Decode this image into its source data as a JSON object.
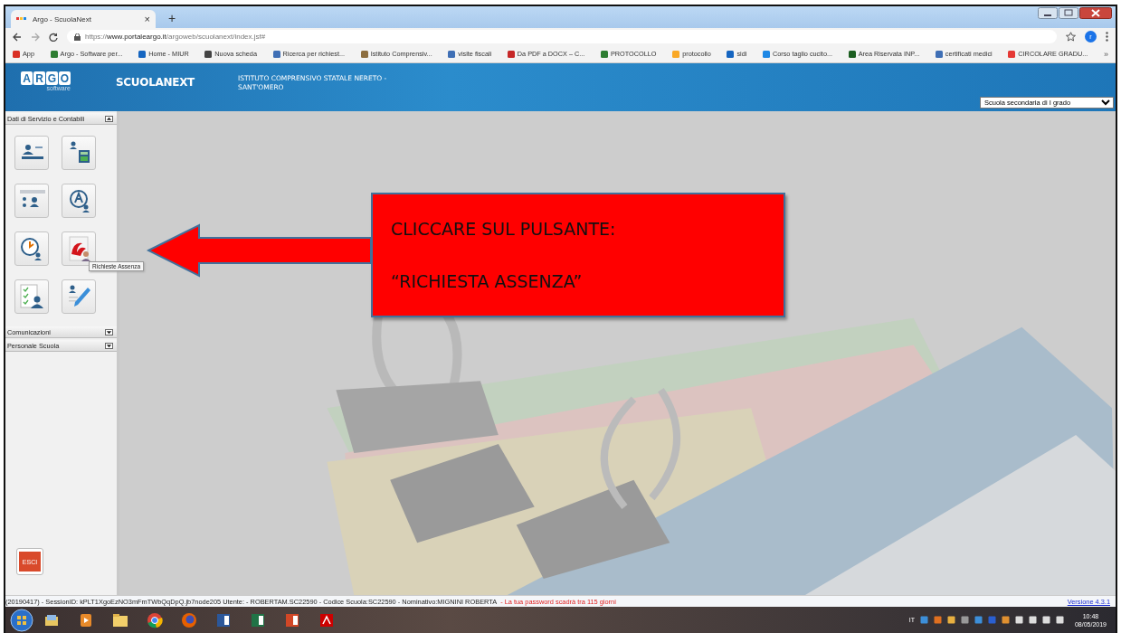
{
  "browser": {
    "tab": {
      "title": "Argo - ScuolaNext",
      "close": "×"
    },
    "new_tab": "+",
    "address": "https://**www.portaleargo.it**/argoweb/scuolanext/index.jsf#",
    "profile_initial": "r",
    "bookmarks": [
      {
        "label": "App",
        "color": "#d93025"
      },
      {
        "label": "Argo - Software per...",
        "color": "#2e7d32"
      },
      {
        "label": "Home - MIUR",
        "color": "#1565c0"
      },
      {
        "label": "Nuova scheda",
        "color": "#444444"
      },
      {
        "label": "Ricerca per richiest...",
        "color": "#3f6fb5"
      },
      {
        "label": "Istituto Comprensiv...",
        "color": "#8d6e3f"
      },
      {
        "label": "visite fiscali",
        "color": "#3f6fb5"
      },
      {
        "label": "Da PDF a DOCX – C...",
        "color": "#c62828"
      },
      {
        "label": "PROTOCOLLO",
        "color": "#2e7d32"
      },
      {
        "label": "protocollo",
        "color": "#f9a825"
      },
      {
        "label": "sidi",
        "color": "#1565c0"
      },
      {
        "label": "Corso taglio cucito...",
        "color": "#1e88e5"
      },
      {
        "label": "Area Riservata INP...",
        "color": "#1b5e20"
      },
      {
        "label": "certificati medici",
        "color": "#3f6fb5"
      },
      {
        "label": "CIRCOLARE GRADU...",
        "color": "#e53935"
      }
    ],
    "more": "»"
  },
  "header": {
    "logo_letters": [
      "A",
      "R",
      "G",
      "O"
    ],
    "logo_sub": "software",
    "product": "SCUOLANEXT",
    "school": [
      "ISTITUTO COMPRENSIVO STATALE NERETO -",
      "SANT'OMERO"
    ],
    "school_type": "Scuola secondaria di I grado"
  },
  "sidebar": {
    "sections": [
      {
        "title": "Dati di Servizio e Contabili",
        "expanded": true
      },
      {
        "title": "Comunicazioni",
        "expanded": false
      },
      {
        "title": "Personale Scuola",
        "expanded": false
      }
    ],
    "tooltip": "Richieste Assenza",
    "exit_label": "ESCI"
  },
  "callout": {
    "lines": [
      "CLICCARE SUL PULSANTE:",
      "“RICHIESTA ASSENZA”"
    ]
  },
  "status_bar": {
    "session": "(20190417) - SessionID: kPLT1XgoEzNO3mFmTWbQqDpQ.jb7node205 Utente: - ROBERTAM.SC22590 - Codice Scuola:SC22590 - Nominativo:MIGNINI ROBERTA",
    "warning": "- La tua password scadrà tra 115 giorni",
    "version": "Versione 4.3.1"
  },
  "taskbar": {
    "language": "IT",
    "time": "10:48",
    "date": "08/05/2019"
  }
}
